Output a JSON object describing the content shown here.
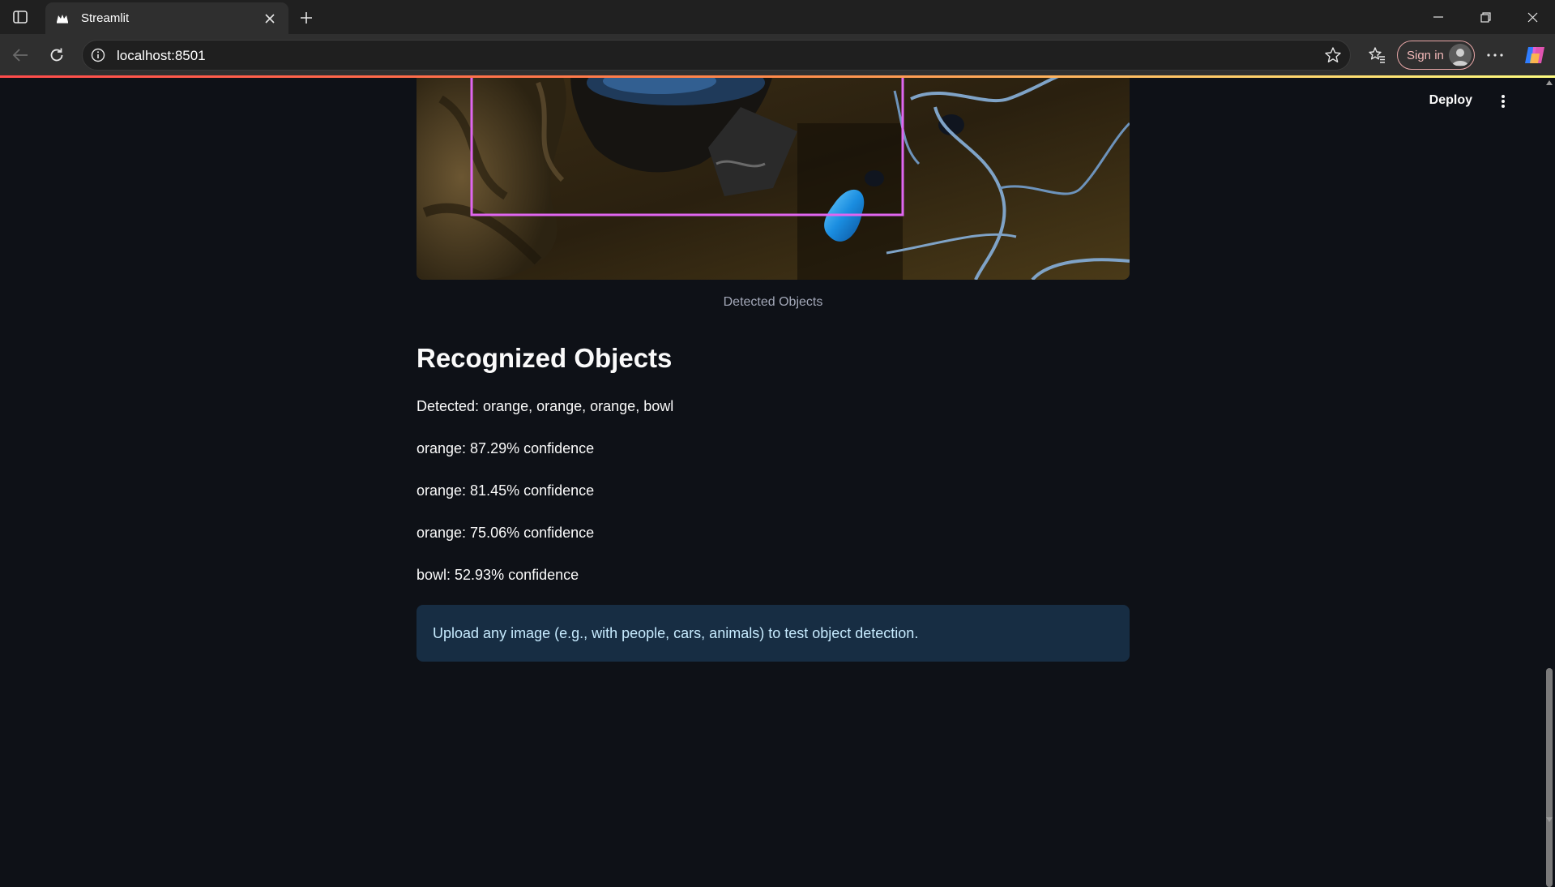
{
  "browser": {
    "tab_title": "Streamlit",
    "url": "localhost:8501",
    "sign_in_label": "Sign in"
  },
  "app": {
    "deploy_label": "Deploy",
    "image_caption": "Detected Objects",
    "heading": "Recognized Objects",
    "detected_summary": "Detected: orange, orange, orange, bowl",
    "results": [
      "orange: 87.29% confidence",
      "orange: 81.45% confidence",
      "orange: 75.06% confidence",
      "bowl: 52.93% confidence"
    ],
    "info_message": "Upload any image (e.g., with people, cars, animals) to test object detection."
  },
  "colors": {
    "background": "#0e1117",
    "info_bg": "#172d43",
    "info_text": "#c7ebff",
    "bbox": "#e066f0"
  }
}
